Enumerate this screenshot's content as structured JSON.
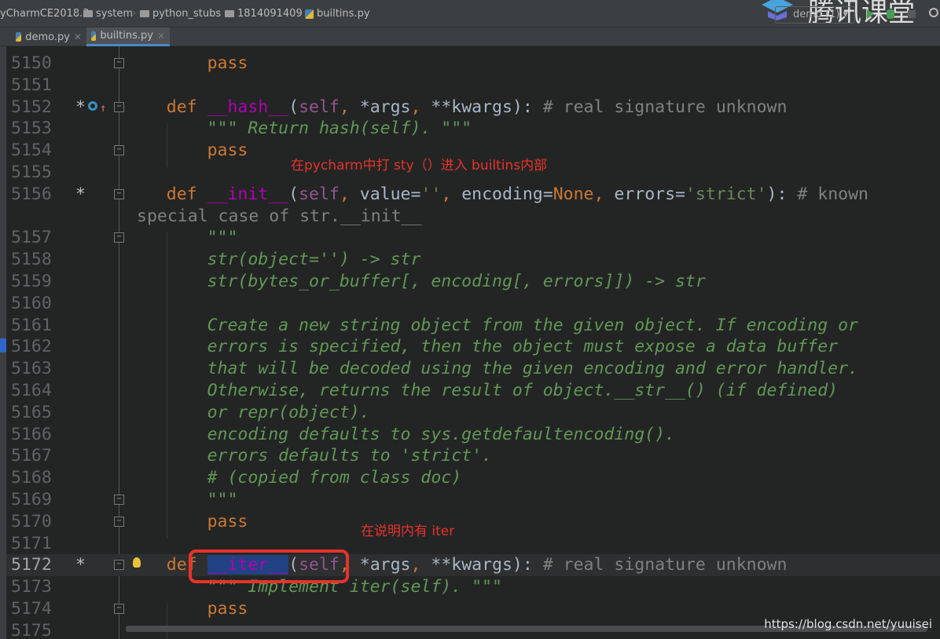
{
  "breadcrumb": [
    "yCharmCE2018.3",
    "system",
    "python_stubs",
    "1814091409",
    "builtins.py"
  ],
  "tabs": [
    {
      "label": "demo.py",
      "active": false
    },
    {
      "label": "builtins.py",
      "active": true
    }
  ],
  "toolbar": {
    "run_config": "demo (1)",
    "run_icon": "play-icon",
    "debug_icon": "bug-icon",
    "stop_icon": "stop-icon",
    "search_icon": "search-icon"
  },
  "watermark_logo": "腾讯课堂",
  "annotations": {
    "note1": "在pycharm中打 sty（）进入 builtins内部",
    "note2": "在说明内有 iter"
  },
  "footer_watermark": "https://blog.csdn.net/yuuisei",
  "colors": {
    "keyword": "#cc7832",
    "function": "#b200b2",
    "self": "#94558d",
    "comment": "#808080",
    "string": "#6a8759",
    "docstring": "#629755",
    "annotation": "#e8322a",
    "selection": "#214283"
  },
  "lines": [
    {
      "num": "5150",
      "fold": true,
      "tokens": [
        [
          "plain",
          "        "
        ],
        [
          "kw",
          "pass"
        ]
      ]
    },
    {
      "num": "5151",
      "tokens": []
    },
    {
      "num": "5152",
      "mark": "*",
      "override": true,
      "fold": true,
      "tokens": [
        [
          "plain",
          "    "
        ],
        [
          "kw",
          "def "
        ],
        [
          "fn",
          "__hash__"
        ],
        [
          "plain",
          "("
        ],
        [
          "self",
          "self"
        ],
        [
          "kw",
          ", "
        ],
        [
          "plain",
          "*args"
        ],
        [
          "kw",
          ", "
        ],
        [
          "plain",
          "**kwargs): "
        ],
        [
          "cm",
          "# real signature unknown"
        ]
      ]
    },
    {
      "num": "5153",
      "tokens": [
        [
          "plain",
          "        "
        ],
        [
          "doc",
          "\"\"\" Return hash(self). \"\"\""
        ]
      ]
    },
    {
      "num": "5154",
      "fold": true,
      "tokens": [
        [
          "plain",
          "        "
        ],
        [
          "kw",
          "pass"
        ]
      ]
    },
    {
      "num": "5155",
      "tokens": []
    },
    {
      "num": "5156",
      "mark": "*",
      "fold": true,
      "tokens": [
        [
          "plain",
          "    "
        ],
        [
          "kw",
          "def "
        ],
        [
          "fn",
          "__init__"
        ],
        [
          "plain",
          "("
        ],
        [
          "self",
          "self"
        ],
        [
          "kw",
          ", "
        ],
        [
          "plain",
          "value="
        ],
        [
          "str",
          "''"
        ],
        [
          "kw",
          ", "
        ],
        [
          "plain",
          "encoding="
        ],
        [
          "nn",
          "None"
        ],
        [
          "kw",
          ", "
        ],
        [
          "plain",
          "errors="
        ],
        [
          "str",
          "'strict'"
        ],
        [
          "plain",
          "): "
        ],
        [
          "cm",
          "# known"
        ]
      ],
      "wrap": [
        [
          "cm",
          "special case of str.__init__"
        ]
      ]
    },
    {
      "num": "5157",
      "fold": true,
      "tokens": [
        [
          "plain",
          "        "
        ],
        [
          "doc",
          "\"\"\""
        ]
      ]
    },
    {
      "num": "5158",
      "tokens": [
        [
          "plain",
          "        "
        ],
        [
          "doc",
          "str(object='') -> str"
        ]
      ]
    },
    {
      "num": "5159",
      "tokens": [
        [
          "plain",
          "        "
        ],
        [
          "doc",
          "str(bytes_or_buffer[, encoding[, errors]]) -> str"
        ]
      ]
    },
    {
      "num": "5160",
      "tokens": []
    },
    {
      "num": "5161",
      "tokens": [
        [
          "plain",
          "        "
        ],
        [
          "doc",
          "Create a new string object from the given object. If encoding or"
        ]
      ]
    },
    {
      "num": "5162",
      "tokens": [
        [
          "plain",
          "        "
        ],
        [
          "doc",
          "errors is specified, then the object must expose a data buffer"
        ]
      ]
    },
    {
      "num": "5163",
      "tokens": [
        [
          "plain",
          "        "
        ],
        [
          "doc",
          "that will be decoded using the given encoding and error handler."
        ]
      ]
    },
    {
      "num": "5164",
      "tokens": [
        [
          "plain",
          "        "
        ],
        [
          "doc",
          "Otherwise, returns the result of object.__str__() (if defined)"
        ]
      ]
    },
    {
      "num": "5165",
      "tokens": [
        [
          "plain",
          "        "
        ],
        [
          "doc",
          "or repr(object)."
        ]
      ]
    },
    {
      "num": "5166",
      "tokens": [
        [
          "plain",
          "        "
        ],
        [
          "doc",
          "encoding defaults to sys.getdefaultencoding()."
        ]
      ]
    },
    {
      "num": "5167",
      "tokens": [
        [
          "plain",
          "        "
        ],
        [
          "doc",
          "errors defaults to 'strict'."
        ]
      ]
    },
    {
      "num": "5168",
      "tokens": [
        [
          "plain",
          "        "
        ],
        [
          "doc",
          "# (copied from class doc)"
        ]
      ]
    },
    {
      "num": "5169",
      "fold": true,
      "tokens": [
        [
          "plain",
          "        "
        ],
        [
          "doc",
          "\"\"\""
        ]
      ]
    },
    {
      "num": "5170",
      "fold": true,
      "tokens": [
        [
          "plain",
          "        "
        ],
        [
          "kw",
          "pass"
        ]
      ]
    },
    {
      "num": "5171",
      "tokens": []
    },
    {
      "num": "5172",
      "mark": "*",
      "fold": true,
      "bulb": true,
      "current": true,
      "tokens": [
        [
          "plain",
          "    "
        ],
        [
          "kw",
          "def "
        ],
        [
          "sel",
          "__iter__"
        ],
        [
          "plain",
          "("
        ],
        [
          "self",
          "self"
        ],
        [
          "kw",
          ", "
        ],
        [
          "plain",
          "*args"
        ],
        [
          "kw",
          ", "
        ],
        [
          "plain",
          "**kwargs): "
        ],
        [
          "cm",
          "# real signature unknown"
        ]
      ]
    },
    {
      "num": "5173",
      "tokens": [
        [
          "plain",
          "        "
        ],
        [
          "doc",
          "\"\"\" Implement iter(self). \"\"\""
        ]
      ]
    },
    {
      "num": "5174",
      "fold": true,
      "tokens": [
        [
          "plain",
          "        "
        ],
        [
          "kw",
          "pass"
        ]
      ]
    },
    {
      "num": "5175",
      "tokens": []
    }
  ]
}
